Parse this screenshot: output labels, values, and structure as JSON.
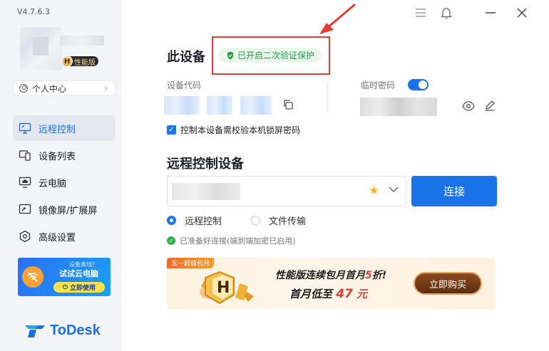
{
  "app": {
    "version": "V4.7.6.3",
    "logo_text": "ToDesk"
  },
  "sidebar": {
    "vip_badge": "性能版",
    "vip_letter": "H",
    "personal_center": "个人中心",
    "items": [
      {
        "label": "远程控制",
        "icon": "remote-control-icon",
        "active": true
      },
      {
        "label": "设备列表",
        "icon": "device-list-icon",
        "active": false
      },
      {
        "label": "云电脑",
        "icon": "cloud-pc-icon",
        "active": false
      },
      {
        "label": "镜像屏/扩展屏",
        "icon": "mirror-screen-icon",
        "active": false
      },
      {
        "label": "高级设置",
        "icon": "settings-icon",
        "active": false
      }
    ],
    "promo": {
      "line1": "设备离线?",
      "line2": "试试云电脑",
      "button": "立即使用"
    }
  },
  "window": {
    "controls": [
      "menu-icon",
      "bell-icon",
      "minimize-icon",
      "close-icon"
    ]
  },
  "device": {
    "title": "此设备",
    "two_factor_badge": "已开启二次验证保护",
    "code_label": "设备代码",
    "temp_password_label": "临时密码",
    "temp_password_enabled": true,
    "lock_password_checkbox": "控制本设备需校验本机锁屏密码",
    "lock_password_checked": true
  },
  "remote": {
    "title": "远程控制设备",
    "connect_button": "连接",
    "modes": [
      {
        "label": "远程控制",
        "selected": true
      },
      {
        "label": "文件传输",
        "selected": false
      }
    ],
    "status": "已准备好连接(端到端加密已启用)"
  },
  "banner": {
    "tag": "五一超值包月",
    "line1_prefix": "性能版连续包月首月",
    "line1_highlight": "5",
    "line1_suffix": "折!",
    "line2_prefix": "首月低至",
    "line2_price": "47",
    "line2_unit": "元",
    "buy_button": "立即购买",
    "graphic_letter": "H"
  },
  "colors": {
    "primary": "#1a73e8",
    "success": "#2a9b4b",
    "annotation": "#e23b33"
  }
}
